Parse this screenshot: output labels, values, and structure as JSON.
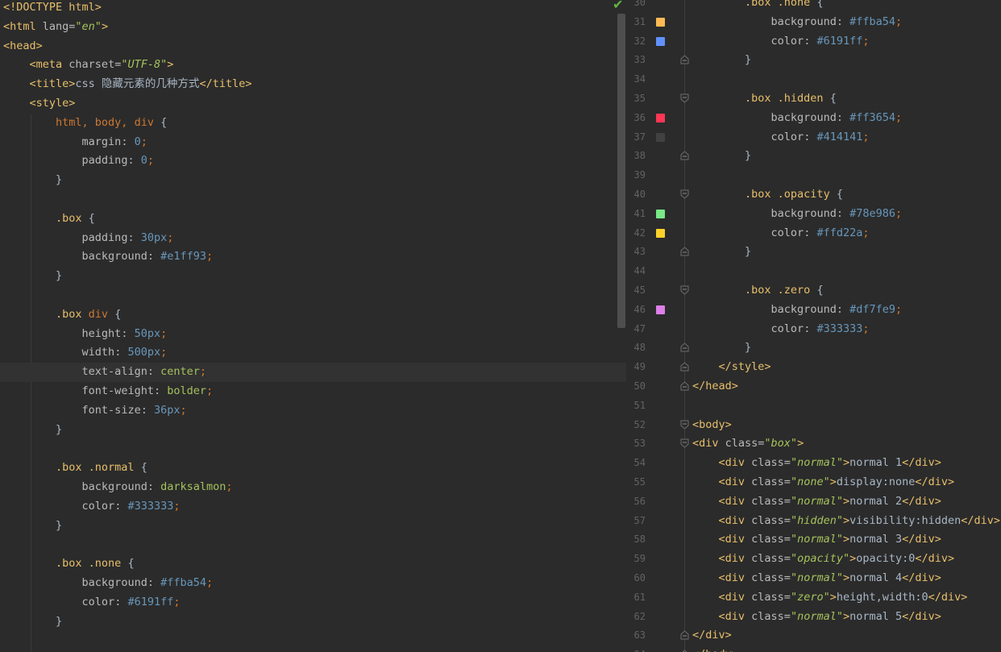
{
  "left": {
    "lines": [
      [
        [
          "t-tag",
          "<!DOCTYPE html>"
        ]
      ],
      [
        [
          "t-tag",
          "<html "
        ],
        [
          "t-attr",
          "lang="
        ],
        [
          "t-str",
          "\"en\""
        ],
        [
          "t-tag",
          ">"
        ]
      ],
      [
        [
          "t-tag",
          "<head>"
        ]
      ],
      [
        [
          "t-text",
          "    "
        ],
        [
          "t-tag",
          "<meta "
        ],
        [
          "t-attr",
          "charset="
        ],
        [
          "t-str",
          "\"UTF-8\""
        ],
        [
          "t-tag",
          ">"
        ]
      ],
      [
        [
          "t-text",
          "    "
        ],
        [
          "t-tag",
          "<title>"
        ],
        [
          "t-text",
          "css 隐藏元素的几种方式"
        ],
        [
          "t-tag",
          "</title>"
        ]
      ],
      [
        [
          "t-text",
          "    "
        ],
        [
          "t-tag",
          "<style>"
        ]
      ],
      [
        [
          "t-text",
          "        "
        ],
        [
          "t-kw",
          "html, body, div "
        ],
        [
          "t-text",
          "{"
        ]
      ],
      [
        [
          "t-text",
          "            "
        ],
        [
          "t-prop",
          "margin"
        ],
        [
          "t-text",
          ": "
        ],
        [
          "t-num",
          "0"
        ],
        [
          "t-punc",
          ";"
        ]
      ],
      [
        [
          "t-text",
          "            "
        ],
        [
          "t-prop",
          "padding"
        ],
        [
          "t-text",
          ": "
        ],
        [
          "t-num",
          "0"
        ],
        [
          "t-punc",
          ";"
        ]
      ],
      [
        [
          "t-text",
          "        }"
        ]
      ],
      [
        [
          "t-text",
          ""
        ]
      ],
      [
        [
          "t-text",
          "        "
        ],
        [
          "t-sel",
          ".box "
        ],
        [
          "t-text",
          "{"
        ]
      ],
      [
        [
          "t-text",
          "            "
        ],
        [
          "t-prop",
          "padding"
        ],
        [
          "t-text",
          ": "
        ],
        [
          "t-num",
          "30px"
        ],
        [
          "t-punc",
          ";"
        ]
      ],
      [
        [
          "t-text",
          "            "
        ],
        [
          "t-prop",
          "background"
        ],
        [
          "t-text",
          ": "
        ],
        [
          "t-num",
          "#e1ff93"
        ],
        [
          "t-punc",
          ";"
        ]
      ],
      [
        [
          "t-text",
          "        }"
        ]
      ],
      [
        [
          "t-text",
          ""
        ]
      ],
      [
        [
          "t-text",
          "        "
        ],
        [
          "t-sel",
          ".box "
        ],
        [
          "t-kw",
          "div "
        ],
        [
          "t-text",
          "{"
        ]
      ],
      [
        [
          "t-text",
          "            "
        ],
        [
          "t-prop",
          "height"
        ],
        [
          "t-text",
          ": "
        ],
        [
          "t-num",
          "50px"
        ],
        [
          "t-punc",
          ";"
        ]
      ],
      [
        [
          "t-text",
          "            "
        ],
        [
          "t-prop",
          "width"
        ],
        [
          "t-text",
          ": "
        ],
        [
          "t-num",
          "500px"
        ],
        [
          "t-punc",
          ";"
        ]
      ],
      [
        [
          "t-text",
          "            "
        ],
        [
          "t-prop",
          "text-align"
        ],
        [
          "t-text",
          ": "
        ],
        [
          "t-val",
          "center"
        ],
        [
          "t-punc",
          ";"
        ]
      ],
      [
        [
          "t-text",
          "            "
        ],
        [
          "t-prop",
          "font-weight"
        ],
        [
          "t-text",
          ": "
        ],
        [
          "t-val",
          "bolder"
        ],
        [
          "t-punc",
          ";"
        ]
      ],
      [
        [
          "t-text",
          "            "
        ],
        [
          "t-prop",
          "font-size"
        ],
        [
          "t-text",
          ": "
        ],
        [
          "t-num",
          "36px"
        ],
        [
          "t-punc",
          ";"
        ]
      ],
      [
        [
          "t-text",
          "        }"
        ]
      ],
      [
        [
          "t-text",
          ""
        ]
      ],
      [
        [
          "t-text",
          "        "
        ],
        [
          "t-sel",
          ".box .normal "
        ],
        [
          "t-text",
          "{"
        ]
      ],
      [
        [
          "t-text",
          "            "
        ],
        [
          "t-prop",
          "background"
        ],
        [
          "t-text",
          ": "
        ],
        [
          "t-val",
          "darksalmon"
        ],
        [
          "t-punc",
          ";"
        ]
      ],
      [
        [
          "t-text",
          "            "
        ],
        [
          "t-prop",
          "color"
        ],
        [
          "t-text",
          ": "
        ],
        [
          "t-num",
          "#333333"
        ],
        [
          "t-punc",
          ";"
        ]
      ],
      [
        [
          "t-text",
          "        }"
        ]
      ],
      [
        [
          "t-text",
          ""
        ]
      ],
      [
        [
          "t-text",
          "        "
        ],
        [
          "t-sel",
          ".box .none "
        ],
        [
          "t-text",
          "{"
        ]
      ],
      [
        [
          "t-text",
          "            "
        ],
        [
          "t-prop",
          "background"
        ],
        [
          "t-text",
          ": "
        ],
        [
          "t-num",
          "#ffba54"
        ],
        [
          "t-punc",
          ";"
        ]
      ],
      [
        [
          "t-text",
          "            "
        ],
        [
          "t-prop",
          "color"
        ],
        [
          "t-text",
          ": "
        ],
        [
          "t-num",
          "#6191ff"
        ],
        [
          "t-punc",
          ";"
        ]
      ],
      [
        [
          "t-text",
          "        }"
        ]
      ],
      [
        [
          "t-text",
          ""
        ]
      ]
    ],
    "caret_line": 19
  },
  "right": {
    "lines": [
      {
        "n": "30",
        "c": [
          [
            "t-text",
            "        "
          ],
          [
            "t-sel",
            ".box .none "
          ],
          [
            "t-text",
            "{"
          ]
        ]
      },
      {
        "n": "31",
        "sw": "#ffba54",
        "c": [
          [
            "t-text",
            "            "
          ],
          [
            "t-prop",
            "background"
          ],
          [
            "t-text",
            ": "
          ],
          [
            "t-num",
            "#ffba54"
          ],
          [
            "t-punc",
            ";"
          ]
        ]
      },
      {
        "n": "32",
        "sw": "#6191ff",
        "c": [
          [
            "t-text",
            "            "
          ],
          [
            "t-prop",
            "color"
          ],
          [
            "t-text",
            ": "
          ],
          [
            "t-num",
            "#6191ff"
          ],
          [
            "t-punc",
            ";"
          ]
        ]
      },
      {
        "n": "33",
        "f": "end",
        "c": [
          [
            "t-text",
            "        }"
          ]
        ]
      },
      {
        "n": "34",
        "c": [
          [
            "t-text",
            ""
          ]
        ]
      },
      {
        "n": "35",
        "f": "start",
        "c": [
          [
            "t-text",
            "        "
          ],
          [
            "t-sel",
            ".box .hidden "
          ],
          [
            "t-text",
            "{"
          ]
        ]
      },
      {
        "n": "36",
        "sw": "#ff3654",
        "c": [
          [
            "t-text",
            "            "
          ],
          [
            "t-prop",
            "background"
          ],
          [
            "t-text",
            ": "
          ],
          [
            "t-num",
            "#ff3654"
          ],
          [
            "t-punc",
            ";"
          ]
        ]
      },
      {
        "n": "37",
        "sw": "#414141",
        "c": [
          [
            "t-text",
            "            "
          ],
          [
            "t-prop",
            "color"
          ],
          [
            "t-text",
            ": "
          ],
          [
            "t-num",
            "#414141"
          ],
          [
            "t-punc",
            ";"
          ]
        ]
      },
      {
        "n": "38",
        "f": "end",
        "c": [
          [
            "t-text",
            "        }"
          ]
        ]
      },
      {
        "n": "39",
        "c": [
          [
            "t-text",
            ""
          ]
        ]
      },
      {
        "n": "40",
        "f": "start",
        "c": [
          [
            "t-text",
            "        "
          ],
          [
            "t-sel",
            ".box .opacity "
          ],
          [
            "t-text",
            "{"
          ]
        ]
      },
      {
        "n": "41",
        "sw": "#78e986",
        "c": [
          [
            "t-text",
            "            "
          ],
          [
            "t-prop",
            "background"
          ],
          [
            "t-text",
            ": "
          ],
          [
            "t-num",
            "#78e986"
          ],
          [
            "t-punc",
            ";"
          ]
        ]
      },
      {
        "n": "42",
        "sw": "#ffd22a",
        "c": [
          [
            "t-text",
            "            "
          ],
          [
            "t-prop",
            "color"
          ],
          [
            "t-text",
            ": "
          ],
          [
            "t-num",
            "#ffd22a"
          ],
          [
            "t-punc",
            ";"
          ]
        ]
      },
      {
        "n": "43",
        "f": "end",
        "c": [
          [
            "t-text",
            "        }"
          ]
        ]
      },
      {
        "n": "44",
        "c": [
          [
            "t-text",
            ""
          ]
        ]
      },
      {
        "n": "45",
        "f": "start",
        "c": [
          [
            "t-text",
            "        "
          ],
          [
            "t-sel",
            ".box .zero "
          ],
          [
            "t-text",
            "{"
          ]
        ]
      },
      {
        "n": "46",
        "sw": "#df7fe9",
        "c": [
          [
            "t-text",
            "            "
          ],
          [
            "t-prop",
            "background"
          ],
          [
            "t-text",
            ": "
          ],
          [
            "t-num",
            "#df7fe9"
          ],
          [
            "t-punc",
            ";"
          ]
        ]
      },
      {
        "n": "47",
        "c": [
          [
            "t-text",
            "            "
          ],
          [
            "t-prop",
            "color"
          ],
          [
            "t-text",
            ": "
          ],
          [
            "t-num",
            "#333333"
          ],
          [
            "t-punc",
            ";"
          ]
        ]
      },
      {
        "n": "48",
        "f": "end",
        "c": [
          [
            "t-text",
            "        }"
          ]
        ]
      },
      {
        "n": "49",
        "f": "end",
        "c": [
          [
            "t-text",
            "    "
          ],
          [
            "t-tag",
            "</style>"
          ]
        ]
      },
      {
        "n": "50",
        "f": "end",
        "c": [
          [
            "t-tag",
            "</head>"
          ]
        ]
      },
      {
        "n": "51",
        "c": [
          [
            "t-text",
            ""
          ]
        ]
      },
      {
        "n": "52",
        "f": "start",
        "c": [
          [
            "t-tag",
            "<body>"
          ]
        ]
      },
      {
        "n": "53",
        "f": "start",
        "c": [
          [
            "t-tag",
            "<div "
          ],
          [
            "t-attr",
            "class="
          ],
          [
            "t-str",
            "\"box\""
          ],
          [
            "t-tag",
            ">"
          ]
        ]
      },
      {
        "n": "54",
        "c": [
          [
            "t-text",
            "    "
          ],
          [
            "t-tag",
            "<div "
          ],
          [
            "t-attr",
            "class="
          ],
          [
            "t-str",
            "\"normal\""
          ],
          [
            "t-tag",
            ">"
          ],
          [
            "t-text",
            "normal 1"
          ],
          [
            "t-tag",
            "</div>"
          ]
        ]
      },
      {
        "n": "55",
        "c": [
          [
            "t-text",
            "    "
          ],
          [
            "t-tag",
            "<div "
          ],
          [
            "t-attr",
            "class="
          ],
          [
            "t-str",
            "\"none\""
          ],
          [
            "t-tag",
            ">"
          ],
          [
            "t-text",
            "display:none"
          ],
          [
            "t-tag",
            "</div>"
          ]
        ]
      },
      {
        "n": "56",
        "c": [
          [
            "t-text",
            "    "
          ],
          [
            "t-tag",
            "<div "
          ],
          [
            "t-attr",
            "class="
          ],
          [
            "t-str",
            "\"normal\""
          ],
          [
            "t-tag",
            ">"
          ],
          [
            "t-text",
            "normal 2"
          ],
          [
            "t-tag",
            "</div>"
          ]
        ]
      },
      {
        "n": "57",
        "c": [
          [
            "t-text",
            "    "
          ],
          [
            "t-tag",
            "<div "
          ],
          [
            "t-attr",
            "class="
          ],
          [
            "t-str",
            "\"hidden\""
          ],
          [
            "t-tag",
            ">"
          ],
          [
            "t-text",
            "visibility:hidden"
          ],
          [
            "t-tag",
            "</div>"
          ]
        ]
      },
      {
        "n": "58",
        "c": [
          [
            "t-text",
            "    "
          ],
          [
            "t-tag",
            "<div "
          ],
          [
            "t-attr",
            "class="
          ],
          [
            "t-str",
            "\"normal\""
          ],
          [
            "t-tag",
            ">"
          ],
          [
            "t-text",
            "normal 3"
          ],
          [
            "t-tag",
            "</div>"
          ]
        ]
      },
      {
        "n": "59",
        "c": [
          [
            "t-text",
            "    "
          ],
          [
            "t-tag",
            "<div "
          ],
          [
            "t-attr",
            "class="
          ],
          [
            "t-str",
            "\"opacity\""
          ],
          [
            "t-tag",
            ">"
          ],
          [
            "t-text",
            "opacity:0"
          ],
          [
            "t-tag",
            "</div>"
          ]
        ]
      },
      {
        "n": "60",
        "c": [
          [
            "t-text",
            "    "
          ],
          [
            "t-tag",
            "<div "
          ],
          [
            "t-attr",
            "class="
          ],
          [
            "t-str",
            "\"normal\""
          ],
          [
            "t-tag",
            ">"
          ],
          [
            "t-text",
            "normal 4"
          ],
          [
            "t-tag",
            "</div>"
          ]
        ]
      },
      {
        "n": "61",
        "c": [
          [
            "t-text",
            "    "
          ],
          [
            "t-tag",
            "<div "
          ],
          [
            "t-attr",
            "class="
          ],
          [
            "t-str",
            "\"zero\""
          ],
          [
            "t-tag",
            ">"
          ],
          [
            "t-text",
            "height,width:0"
          ],
          [
            "t-tag",
            "</div>"
          ]
        ]
      },
      {
        "n": "62",
        "c": [
          [
            "t-text",
            "    "
          ],
          [
            "t-tag",
            "<div "
          ],
          [
            "t-attr",
            "class="
          ],
          [
            "t-str",
            "\"normal\""
          ],
          [
            "t-tag",
            ">"
          ],
          [
            "t-text",
            "normal 5"
          ],
          [
            "t-tag",
            "</div>"
          ]
        ]
      },
      {
        "n": "63",
        "f": "end",
        "c": [
          [
            "t-tag",
            "</div>"
          ]
        ]
      },
      {
        "n": "64",
        "f": "end",
        "c": [
          [
            "t-tag",
            "</body>"
          ]
        ]
      }
    ]
  },
  "status": {
    "inspection_ok": "✔"
  }
}
